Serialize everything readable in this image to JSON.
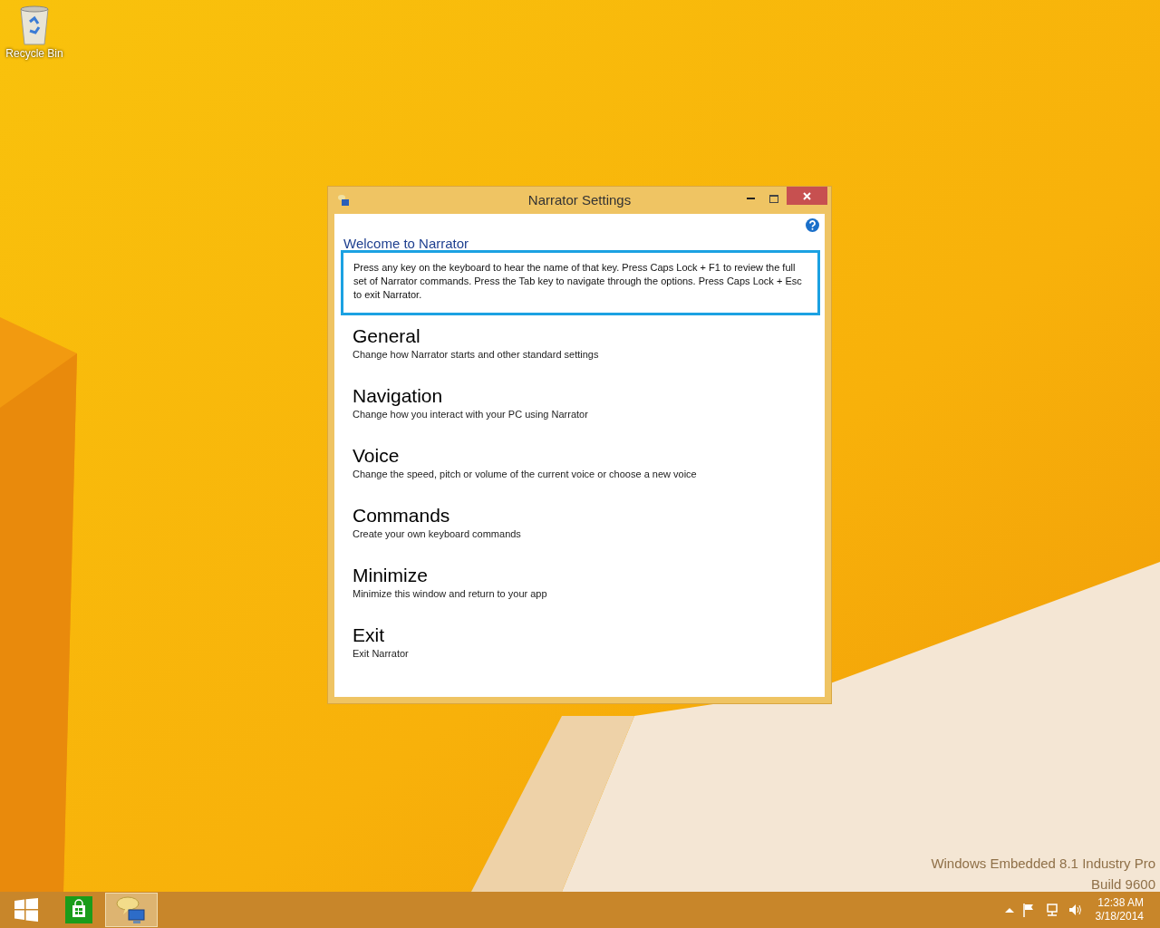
{
  "desktop": {
    "icons": [
      {
        "label": "Recycle Bin"
      }
    ],
    "edition": [
      "Windows Embedded 8.1 Industry Pro",
      "Build 9600"
    ]
  },
  "window": {
    "title": "Narrator Settings",
    "heading": "Welcome to Narrator",
    "intro": "Press any key on the keyboard to hear the name of that key.  Press Caps Lock + F1 to review the full set of Narrator commands.  Press the Tab key to navigate through the options.  Press Caps Lock + Esc to exit Narrator.",
    "sections": [
      {
        "title": "General",
        "description": "Change how Narrator starts and other standard settings"
      },
      {
        "title": "Navigation",
        "description": "Change how you interact with your PC using Narrator"
      },
      {
        "title": "Voice",
        "description": "Change the speed, pitch or volume of the current voice or choose a new voice"
      },
      {
        "title": "Commands",
        "description": "Create your own keyboard commands"
      },
      {
        "title": "Minimize",
        "description": "Minimize this window and return to your app"
      },
      {
        "title": "Exit",
        "description": "Exit Narrator"
      }
    ]
  },
  "taskbar": {
    "apps": [
      {
        "kind": "start",
        "selected": false
      },
      {
        "kind": "store",
        "selected": false
      },
      {
        "kind": "narrator",
        "selected": true
      }
    ],
    "time": "12:38 AM",
    "date": "3/18/2014"
  }
}
